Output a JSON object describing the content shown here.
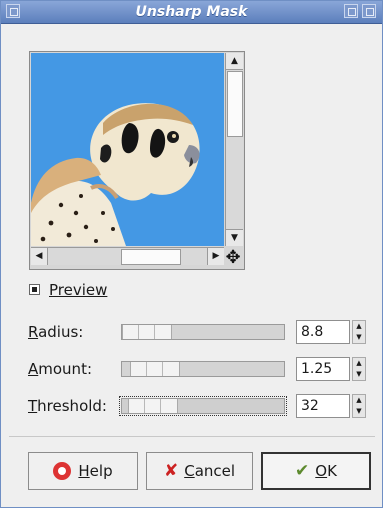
{
  "window": {
    "title": "Unsharp Mask"
  },
  "icons": {
    "title_menu": "window-menu-icon",
    "maximize": "maximize-icon",
    "close": "close-icon",
    "navigate": "move-arrows-icon",
    "help": "lifebuoy-icon",
    "cancel": "cross-icon",
    "ok": "check-icon"
  },
  "preview": {
    "label": "Preview",
    "checked": true,
    "image_subject": "kestrel bird head on blue background"
  },
  "params": {
    "radius": {
      "label_first": "R",
      "label_rest": "adius:",
      "value": "8.8"
    },
    "amount": {
      "label_first": "A",
      "label_rest": "mount:",
      "value": "1.25"
    },
    "threshold": {
      "label_first": "T",
      "label_rest": "hreshold:",
      "value": "32"
    }
  },
  "buttons": {
    "help": {
      "first": "H",
      "rest": "elp"
    },
    "cancel": {
      "first": "C",
      "rest": "ancel"
    },
    "ok": {
      "first": "O",
      "rest": "K"
    }
  }
}
